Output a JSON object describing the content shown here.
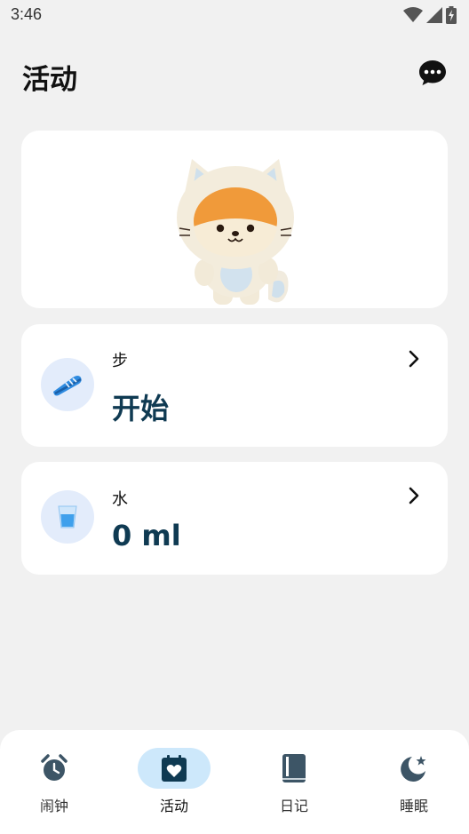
{
  "status_bar": {
    "time": "3:46",
    "icons": [
      "wifi-icon",
      "signal-icon",
      "battery-icon"
    ]
  },
  "header": {
    "title": "活动",
    "chat_icon": "chat-bubble-icon"
  },
  "mascot_card": {
    "image": "fox-mascot-in-cat-hood"
  },
  "steps_card": {
    "label": "步",
    "value": "开始",
    "icon": "sneaker-icon"
  },
  "water_card": {
    "label": "水",
    "value": "0 ml",
    "icon": "water-glass-icon"
  },
  "bottom_nav": {
    "items": [
      {
        "label": "闹钟",
        "icon": "alarm-clock-icon",
        "active": false
      },
      {
        "label": "活动",
        "icon": "calendar-heart-icon",
        "active": true
      },
      {
        "label": "日记",
        "icon": "book-icon",
        "active": false
      },
      {
        "label": "睡眠",
        "icon": "moon-star-icon",
        "active": false
      }
    ]
  },
  "colors": {
    "background": "#f1f1f1",
    "card": "#ffffff",
    "value_text": "#0f3a52",
    "icon_circle": "#e3ecfb",
    "nav_active": "#cde8fb",
    "nav_icon": "#3d5566"
  }
}
